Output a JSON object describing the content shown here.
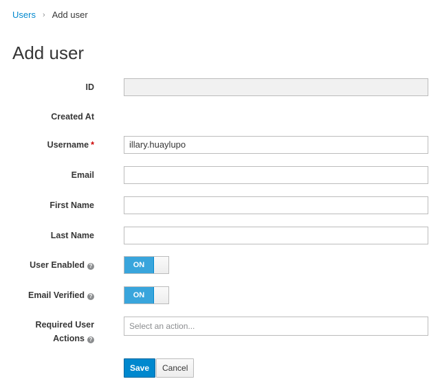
{
  "breadcrumb": {
    "parent": "Users",
    "separator": "›",
    "current": "Add user"
  },
  "page_title": "Add user",
  "form": {
    "id": {
      "label": "ID",
      "value": ""
    },
    "created_at": {
      "label": "Created At",
      "value": ""
    },
    "username": {
      "label": "Username",
      "required_marker": "*",
      "value": "illary.huaylupo"
    },
    "email": {
      "label": "Email",
      "value": ""
    },
    "first_name": {
      "label": "First Name",
      "value": ""
    },
    "last_name": {
      "label": "Last Name",
      "value": ""
    },
    "user_enabled": {
      "label": "User Enabled",
      "state": "ON"
    },
    "email_verified": {
      "label": "Email Verified",
      "state": "ON"
    },
    "required_actions": {
      "label_line1": "Required User",
      "label_line2": "Actions",
      "placeholder": "Select an action..."
    }
  },
  "buttons": {
    "save": "Save",
    "cancel": "Cancel"
  },
  "icons": {
    "help": "question-circle-icon"
  },
  "colors": {
    "link": "#0088ce",
    "toggle_on": "#39a5dc",
    "primary_button": "#0088ce",
    "required": "#cc0000"
  }
}
